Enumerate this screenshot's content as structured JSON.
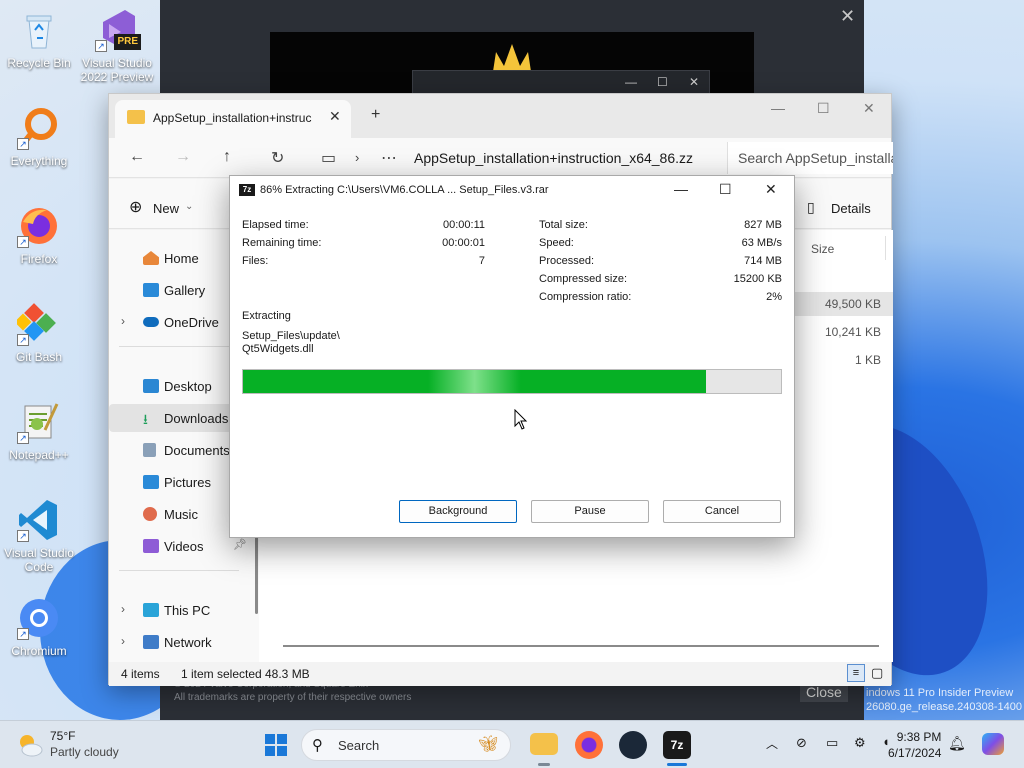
{
  "desktop": {
    "icons": [
      {
        "label": "Recycle Bin"
      },
      {
        "label": "Visual Studio 2022 Preview",
        "badge": "PRE"
      },
      {
        "label": "Everything"
      },
      {
        "label": "Firefox"
      },
      {
        "label": "Git Bash"
      },
      {
        "label": "Notepad++"
      },
      {
        "label": "Visual Studio Code"
      },
      {
        "label": "Chromium"
      }
    ],
    "watermark_line1": "indows 11 Pro Insider Preview",
    "watermark_line2": "26080.ge_release.240308-1400"
  },
  "background_window": {
    "footer_line1": "© 2024 Valve Corporation, and Square Enix",
    "footer_line2": "All trademarks are property of their respective owners",
    "close_button": "Close"
  },
  "explorer": {
    "tab_title": "AppSetup_installation+instruc",
    "path": "AppSetup_installation+instruction_x64_86.zz",
    "search_placeholder": "Search AppSetup_installa",
    "new_label": "New",
    "details_label": "Details",
    "column_size": "Size",
    "sizes": [
      "49,500 KB",
      "10,241 KB",
      "1 KB"
    ],
    "nav": {
      "home": "Home",
      "gallery": "Gallery",
      "onedrive": "OneDrive",
      "desktop": "Desktop",
      "downloads": "Downloads",
      "documents": "Documents",
      "pictures": "Pictures",
      "music": "Music",
      "videos": "Videos",
      "thispc": "This PC",
      "network": "Network"
    },
    "status_items": "4 items",
    "status_selected": "1 item selected",
    "status_size": "48.3 MB"
  },
  "zip": {
    "title": "86% Extracting C:\\Users\\VM6.COLLA ... Setup_Files.v3.rar",
    "logo": "7z",
    "progress_percent": 86,
    "stats_left": [
      {
        "label": "Elapsed time:",
        "value": "00:00:11"
      },
      {
        "label": "Remaining time:",
        "value": "00:00:01"
      },
      {
        "label": "Files:",
        "value": "7"
      }
    ],
    "stats_right": [
      {
        "label": "Total size:",
        "value": "827 MB"
      },
      {
        "label": "Speed:",
        "value": "63 MB/s"
      },
      {
        "label": "Processed:",
        "value": "714 MB"
      },
      {
        "label": "Compressed size:",
        "value": "15200 KB"
      },
      {
        "label": "Compression ratio:",
        "value": "2%"
      }
    ],
    "status_heading": "Extracting",
    "current_file_line1": "Setup_Files\\update\\",
    "current_file_line2": "Qt5Widgets.dll",
    "buttons": {
      "background": "Background",
      "pause": "Pause",
      "cancel": "Cancel"
    }
  },
  "taskbar": {
    "weather_temp": "75°F",
    "weather_desc": "Partly cloudy",
    "search_placeholder": "Search",
    "time": "9:38 PM",
    "date": "6/17/2024"
  }
}
